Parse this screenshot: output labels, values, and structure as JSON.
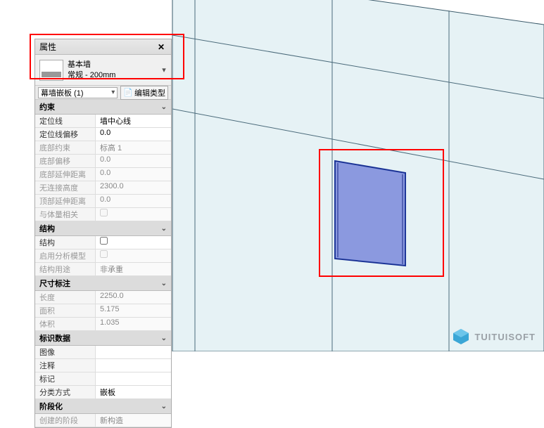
{
  "props_panel": {
    "title": "属性",
    "type_selector": {
      "family": "基本墙",
      "type": "常规 - 200mm"
    },
    "instance_label": "幕墙嵌板 (1)",
    "edit_type_label": "编辑类型",
    "sections": {
      "constraints": {
        "title": "约束",
        "rows": [
          {
            "label": "定位线",
            "value": "墙中心线",
            "enabled": true
          },
          {
            "label": "定位线偏移",
            "value": "0.0",
            "enabled": true
          },
          {
            "label": "底部约束",
            "value": "标高 1",
            "enabled": false
          },
          {
            "label": "底部偏移",
            "value": "0.0",
            "enabled": false
          },
          {
            "label": "底部延伸距离",
            "value": "0.0",
            "enabled": false
          },
          {
            "label": "无连接高度",
            "value": "2300.0",
            "enabled": false
          },
          {
            "label": "顶部延伸距离",
            "value": "0.0",
            "enabled": false
          },
          {
            "label": "与体量相关",
            "value": "",
            "checkbox": true,
            "checked": false,
            "enabled": false
          }
        ]
      },
      "structural": {
        "title": "结构",
        "rows": [
          {
            "label": "结构",
            "value": "",
            "checkbox": true,
            "checked": false,
            "enabled": true
          },
          {
            "label": "启用分析模型",
            "value": "",
            "checkbox": true,
            "checked": false,
            "enabled": false
          },
          {
            "label": "结构用途",
            "value": "非承重",
            "enabled": false
          }
        ]
      },
      "dimensions": {
        "title": "尺寸标注",
        "rows": [
          {
            "label": "长度",
            "value": "2250.0",
            "enabled": false
          },
          {
            "label": "面积",
            "value": "5.175",
            "enabled": false
          },
          {
            "label": "体积",
            "value": "1.035",
            "enabled": false
          }
        ]
      },
      "identity": {
        "title": "标识数据",
        "rows": [
          {
            "label": "图像",
            "value": "",
            "enabled": true
          },
          {
            "label": "注释",
            "value": "",
            "enabled": true
          },
          {
            "label": "标记",
            "value": "",
            "enabled": true
          },
          {
            "label": "分类方式",
            "value": "嵌板",
            "enabled": true
          }
        ]
      },
      "phasing": {
        "title": "阶段化",
        "rows": [
          {
            "label": "创建的阶段",
            "value": "新构造",
            "enabled": false
          }
        ]
      }
    }
  },
  "watermark": {
    "text": "TUITUISOFT"
  }
}
